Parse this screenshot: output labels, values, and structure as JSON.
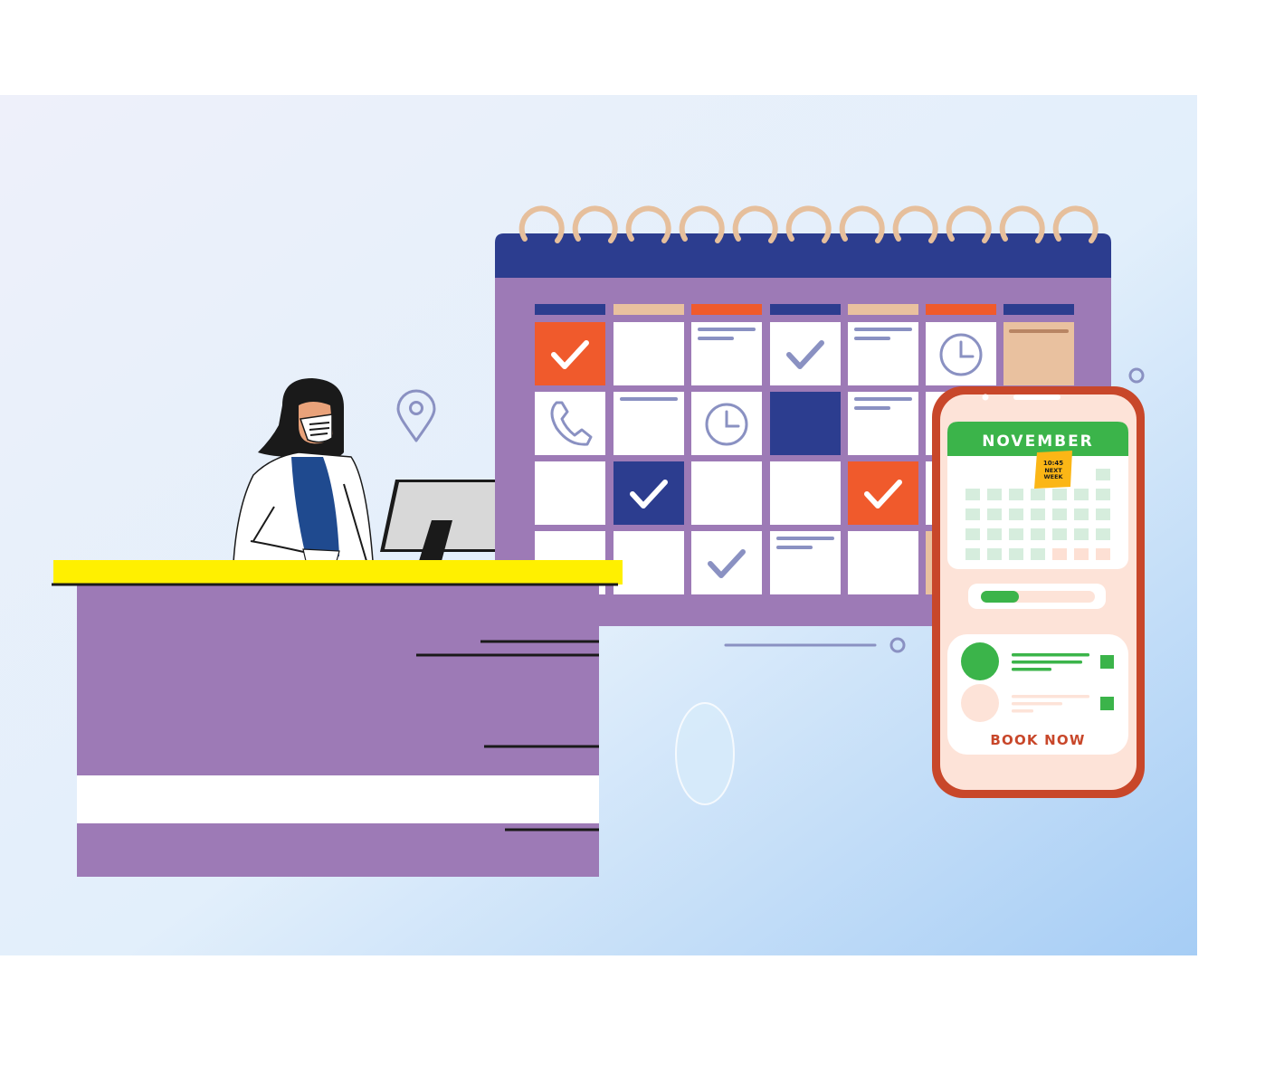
{
  "phone": {
    "month_label": "NOVEMBER",
    "sticky_note": {
      "time": "10:45",
      "line1": "NEXT",
      "line2": "WEEK"
    },
    "progress_fraction": 0.33,
    "book_button_label": "BOOK NOW"
  },
  "colors": {
    "panel_bg_start": "#eef0fa",
    "panel_bg_end": "#a8d0f5",
    "calendar_frame": "#9d7ab6",
    "calendar_header": "#2c3d8f",
    "ring": "#e6bf9c",
    "orange": "#f05a2c",
    "navy": "#2c3d8f",
    "peach": "#e9c19f",
    "desk_top": "#fff000",
    "phone_body": "#c8472a",
    "phone_screen": "#fde3d8",
    "green": "#3bb44a"
  },
  "icons": [
    "check-icon",
    "clock-icon",
    "phone-call-icon",
    "location-pin-icon"
  ]
}
